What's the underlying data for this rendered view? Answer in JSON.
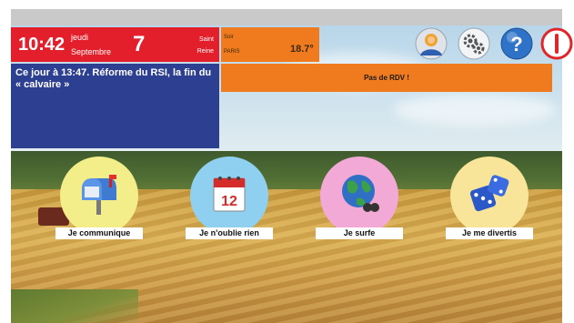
{
  "header": {
    "time": "10:42",
    "day_name": "jeudi",
    "month": "Septembre",
    "day_number": "7",
    "saint_line1": "Saint",
    "saint_line2": "Reine"
  },
  "weather": {
    "line1": "Soir",
    "city": "PARIS",
    "temperature": "18.7°"
  },
  "news": {
    "text": "Ce jour à 13:47. Réforme du RSI, la fin du « calvaire »"
  },
  "agenda": {
    "text": "Pas de RDV !"
  },
  "controls": [
    {
      "icon": "user-avatar-icon"
    },
    {
      "icon": "gears-settings-icon"
    },
    {
      "icon": "help-icon"
    },
    {
      "icon": "power-icon"
    }
  ],
  "apps": [
    {
      "label": "Je communique",
      "icon": "mailbox-icon",
      "color": "#f4ee8a"
    },
    {
      "label": "Je n'oublie rien",
      "icon": "calendar-icon",
      "calendar_day": "12",
      "color": "#8fd0f0"
    },
    {
      "label": "Je surfe",
      "icon": "globe-icon",
      "color": "#f3a9d6"
    },
    {
      "label": "Je me divertis",
      "icon": "dice-icon",
      "color": "#f8e59a"
    }
  ],
  "colors": {
    "date_red": "#e21f2b",
    "weather_orange": "#f07a1e",
    "news_blue": "#2d3f90"
  }
}
